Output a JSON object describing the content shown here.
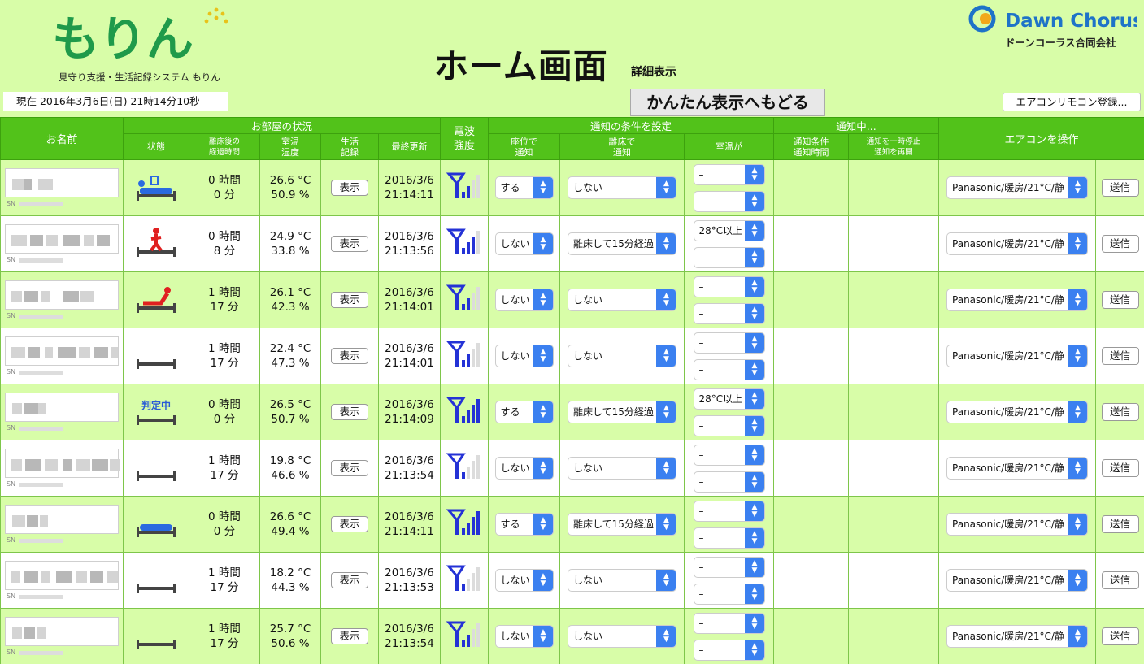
{
  "header": {
    "tagline": "見守り支援・生活記録システム もりん",
    "clock": "現在 2016年3月6日(日) 21時14分10秒",
    "title": "ホーム画面",
    "subtitle": "詳細表示",
    "simple_view_button": "かんたん表示へもどる",
    "company_logo": "Dawn Chorus",
    "company_name": "ドーンコーラス合同会社",
    "ac_register_button": "エアコンリモコン登録..."
  },
  "logo_text": "もりん",
  "colors": {
    "header_green": "#52c21a",
    "background": "#d8fda8",
    "select_blue": "#3b80f0",
    "signal_blue": "#2432d6",
    "alert_red": "#e02020"
  },
  "table": {
    "col_name": "お名前",
    "group_room": "お部屋の状況",
    "col_status": "状態",
    "col_elapsed": "離床後の\n経過時間",
    "col_temp_humid": "室温\n湿度",
    "col_life_log": "生活\n記録",
    "col_last_update": "最終更新",
    "col_signal": "電波\n強度",
    "group_notify_cond": "通知の条件を設定",
    "col_seat": "座位で\n通知",
    "col_leave": "離床で\n通知",
    "col_room_temp": "室温が",
    "group_notifying": "通知中...",
    "col_notify_time": "通知条件\n通知時間",
    "col_resume": "通知を一時停止\n通知を再開",
    "col_ac": "エアコンを操作",
    "show_label": "表示",
    "send_label": "送信",
    "sn_label": "SN",
    "judging_label": "判定中",
    "rows": [
      {
        "status": "lying",
        "hours": "0 時間",
        "minutes": "0 分",
        "temp": "26.6 °C",
        "humid": "50.9 %",
        "date": "2016/3/6",
        "time": "21:14:11",
        "signal": 2,
        "seat": "する",
        "leave": "しない",
        "t1": "–",
        "t2": "–",
        "ac": "Panasonic/暖房/21°C/静"
      },
      {
        "status": "standing",
        "hours": "0 時間",
        "minutes": "8 分",
        "temp": "24.9 °C",
        "humid": "33.8 %",
        "date": "2016/3/6",
        "time": "21:13:56",
        "signal": 3,
        "seat": "しない",
        "leave": "離床して15分経過",
        "t1": "28°C以上",
        "t2": "–",
        "ac": "Panasonic/暖房/21°C/静"
      },
      {
        "status": "sitting",
        "hours": "1 時間",
        "minutes": "17 分",
        "temp": "26.1 °C",
        "humid": "42.3 %",
        "date": "2016/3/6",
        "time": "21:14:01",
        "signal": 2,
        "seat": "しない",
        "leave": "しない",
        "t1": "–",
        "t2": "–",
        "ac": "Panasonic/暖房/21°C/静"
      },
      {
        "status": "empty",
        "hours": "1 時間",
        "minutes": "17 分",
        "temp": "22.4 °C",
        "humid": "47.3 %",
        "date": "2016/3/6",
        "time": "21:14:01",
        "signal": 2,
        "seat": "しない",
        "leave": "しない",
        "t1": "–",
        "t2": "–",
        "ac": "Panasonic/暖房/21°C/静"
      },
      {
        "status": "judging",
        "hours": "0 時間",
        "minutes": "0 分",
        "temp": "26.5 °C",
        "humid": "50.7 %",
        "date": "2016/3/6",
        "time": "21:14:09",
        "signal": 4,
        "seat": "する",
        "leave": "離床して15分経過",
        "t1": "28°C以上",
        "t2": "–",
        "ac": "Panasonic/暖房/21°C/静"
      },
      {
        "status": "empty",
        "hours": "1 時間",
        "minutes": "17 分",
        "temp": "19.8 °C",
        "humid": "46.6 %",
        "date": "2016/3/6",
        "time": "21:13:54",
        "signal": 1,
        "seat": "しない",
        "leave": "しない",
        "t1": "–",
        "t2": "–",
        "ac": "Panasonic/暖房/21°C/静"
      },
      {
        "status": "lying-flat",
        "hours": "0 時間",
        "minutes": "0 分",
        "temp": "26.6 °C",
        "humid": "49.4 %",
        "date": "2016/3/6",
        "time": "21:14:11",
        "signal": 4,
        "seat": "する",
        "leave": "離床して15分経過",
        "t1": "–",
        "t2": "–",
        "ac": "Panasonic/暖房/21°C/静"
      },
      {
        "status": "empty",
        "hours": "1 時間",
        "minutes": "17 分",
        "temp": "18.2 °C",
        "humid": "44.3 %",
        "date": "2016/3/6",
        "time": "21:13:53",
        "signal": 1,
        "seat": "しない",
        "leave": "しない",
        "t1": "–",
        "t2": "–",
        "ac": "Panasonic/暖房/21°C/静"
      },
      {
        "status": "empty",
        "hours": "1 時間",
        "minutes": "17 分",
        "temp": "25.7 °C",
        "humid": "50.6 %",
        "date": "2016/3/6",
        "time": "21:13:54",
        "signal": 2,
        "seat": "しない",
        "leave": "しない",
        "t1": "–",
        "t2": "–",
        "ac": "Panasonic/暖房/21°C/静"
      }
    ]
  }
}
